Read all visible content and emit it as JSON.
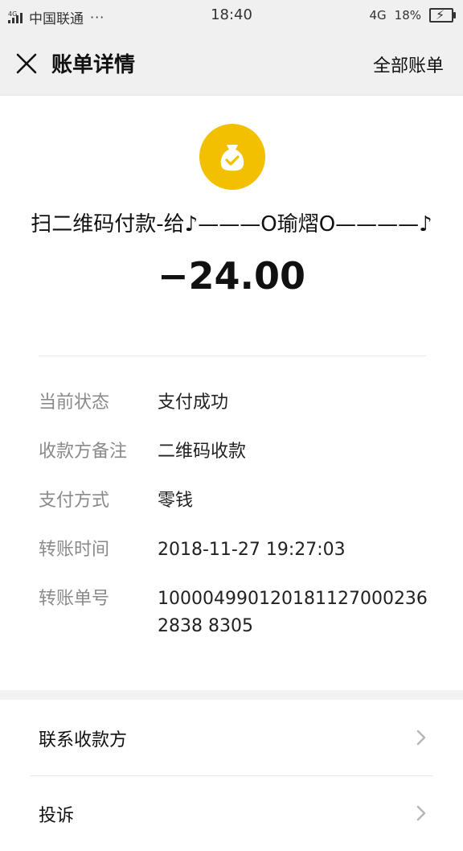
{
  "status_bar": {
    "network_tag": "4G",
    "carrier": "中国联通",
    "dots": "···",
    "time": "18:40",
    "network": "4G",
    "battery": "18%"
  },
  "header": {
    "title": "账单详情",
    "all_bills": "全部账单"
  },
  "payment": {
    "payee": "扫二维码付款-给♪———O瑜熠O————♪",
    "amount": "−24.00"
  },
  "details": [
    {
      "label": "当前状态",
      "value": "支付成功"
    },
    {
      "label": "收款方备注",
      "value": "二维码收款"
    },
    {
      "label": "支付方式",
      "value": "零钱"
    },
    {
      "label": "转账时间",
      "value": "2018-11-27 19:27:03"
    },
    {
      "label": "转账单号",
      "value": "1000049901201811270002362838 8305"
    }
  ],
  "actions": [
    {
      "label": "联系收款方"
    },
    {
      "label": "投诉"
    }
  ],
  "colors": {
    "accent": "#f2c000",
    "header_bg": "#f0f0f0",
    "label_gray": "#8a8a8a"
  }
}
